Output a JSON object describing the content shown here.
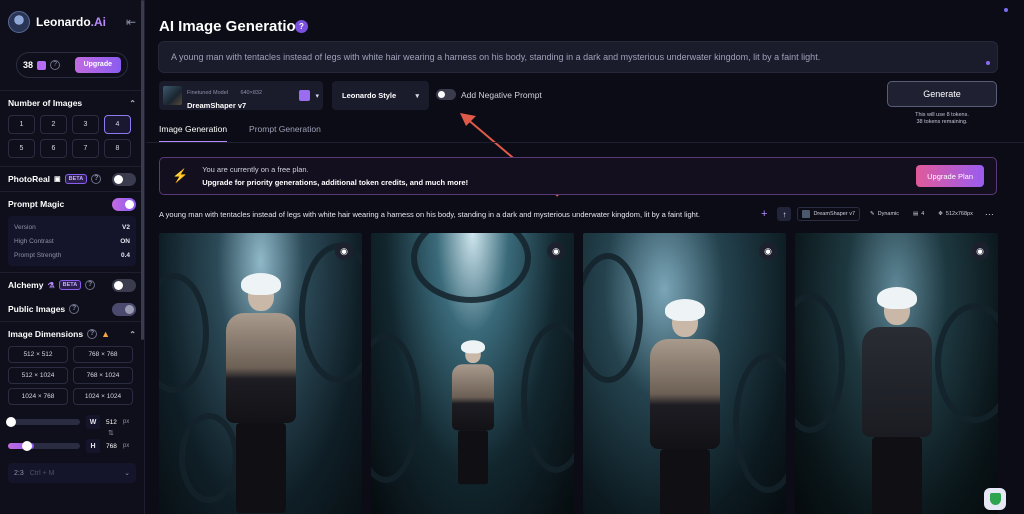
{
  "sidebar": {
    "brand": {
      "name": "Leonardo",
      "suffix": ".Ai"
    },
    "tokens": {
      "count": "38",
      "upgrade_label": "Upgrade"
    },
    "number_of_images": {
      "title": "Number of Images",
      "options": [
        "1",
        "2",
        "3",
        "4",
        "5",
        "6",
        "7",
        "8"
      ],
      "selected": "4"
    },
    "photoreal": {
      "label": "PhotoReal",
      "badge": "BETA",
      "on": false
    },
    "prompt_magic": {
      "label": "Prompt Magic",
      "on": true,
      "rows": [
        {
          "label": "Version",
          "value": "V2"
        },
        {
          "label": "High Contrast",
          "value": "ON"
        },
        {
          "label": "Prompt Strength",
          "value": "0.4"
        }
      ]
    },
    "alchemy": {
      "label": "Alchemy",
      "badge": "BETA",
      "on": false
    },
    "public_images": {
      "label": "Public Images",
      "on": true
    },
    "image_dimensions": {
      "title": "Image Dimensions",
      "options": [
        "512 × 512",
        "768 × 768",
        "512 × 1024",
        "768 × 1024",
        "1024 × 768",
        "1024 × 1024"
      ]
    },
    "width": {
      "label": "W",
      "value": "512",
      "unit": "px"
    },
    "height": {
      "label": "H",
      "value": "768",
      "unit": "px"
    },
    "ratio": {
      "value": "2:3",
      "shortcut": "Ctrl + M"
    }
  },
  "main": {
    "title": "AI Image Generation",
    "prompt": "A young man with tentacles instead of legs with white hair wearing a harness on his body, standing in a dark and mysterious underwater kingdom, lit by a faint light.",
    "model": {
      "kind": "Finetuned Model",
      "resolution": "640×832",
      "name": "DreamShaper v7"
    },
    "style": "Leonardo Style",
    "negative_prompt_label": "Add Negative Prompt",
    "generate_label": "Generate",
    "generate_note_1": "This will use 8 tokens.",
    "generate_note_2": "38 tokens remaining.",
    "tabs": [
      "Image Generation",
      "Prompt Generation"
    ],
    "promo": {
      "line1": "You are currently on a free plan.",
      "line2": "Upgrade for priority generations, additional token credits, and much more!",
      "button": "Upgrade Plan"
    },
    "generation": {
      "prompt": "A young man with tentacles instead of legs with white hair wearing a harness on his body, standing in a dark and mysterious underwater kingdom, lit by a faint light.",
      "model": "DreamShaper v7",
      "style": "Dynamic",
      "count": "4",
      "size": "512x768px"
    }
  },
  "colors": {
    "accent": "#8a5cf0",
    "background": "#0b0c15"
  }
}
